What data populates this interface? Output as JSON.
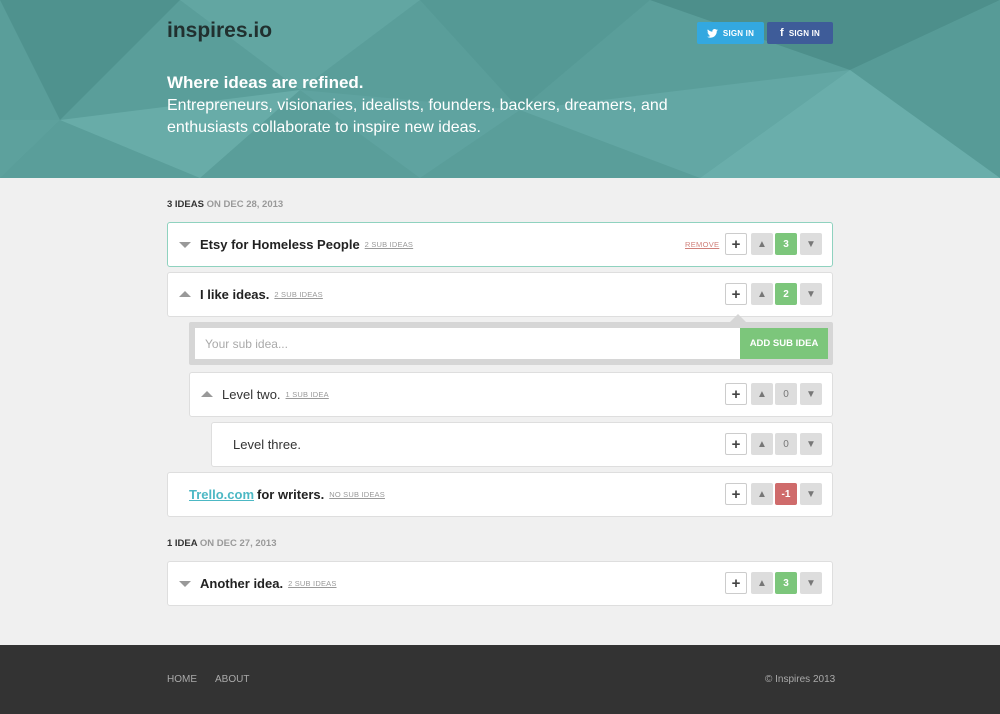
{
  "header": {
    "logo": "inspires.io",
    "twitter_signin": "SIGN IN",
    "facebook_signin": "SIGN IN",
    "tagline": "Where ideas are refined.",
    "subtitle": "Entrepreneurs, visionaries, idealists, founders, backers, dreamers, and enthusiasts collaborate to inspire new ideas."
  },
  "groups": [
    {
      "count": "3 IDEAS",
      "date": "ON DEC 28, 2013"
    },
    {
      "count": "1 IDEA",
      "date": "ON DEC 27, 2013"
    }
  ],
  "ideas": [
    {
      "title": "Etsy for Homeless People",
      "sub": "2 SUB IDEAS",
      "score": "3",
      "remove": "REMOVE"
    },
    {
      "title": "I like ideas.",
      "sub": "2 SUB IDEAS",
      "score": "2"
    },
    {
      "title": "Level two.",
      "sub": "1 SUB IDEA",
      "score": "0"
    },
    {
      "title": "Level three.",
      "score": "0"
    },
    {
      "link": "Trello.com",
      "title": "for writers.",
      "sub": "NO SUB IDEAS",
      "score": "-1"
    },
    {
      "title": "Another idea.",
      "sub": "2 SUB IDEAS",
      "score": "3"
    }
  ],
  "subform": {
    "placeholder": "Your sub idea...",
    "button": "ADD SUB IDEA"
  },
  "footer": {
    "home": "HOME",
    "about": "ABOUT",
    "copyright": "© Inspires 2013"
  },
  "icons": {
    "twitter": "twitter-icon",
    "facebook": "facebook-icon",
    "plus": "plus-icon",
    "thumbs_up": "thumbs-up-icon",
    "thumbs_down": "thumbs-down-icon",
    "collapse": "triangle-down-icon",
    "expand": "triangle-up-icon"
  },
  "colors": {
    "hero": "#5a9e9a",
    "positive": "#7cc67b",
    "negative": "#cf6b6b",
    "twitter": "#33a8e0",
    "facebook": "#3e5c99",
    "link": "#4cb8c4"
  }
}
